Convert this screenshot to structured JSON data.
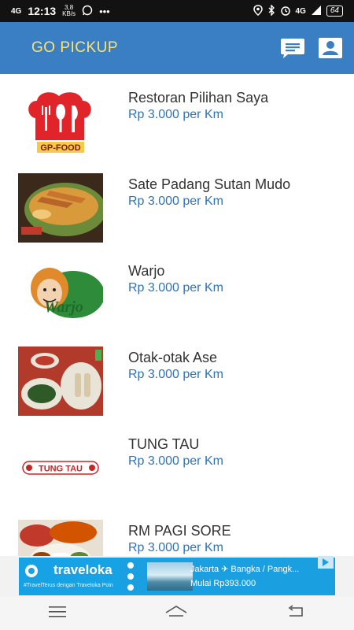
{
  "status_bar": {
    "network_left": "4G",
    "time": "12:13",
    "speed_value": "3,8",
    "speed_unit": "KB/s",
    "more": "•••",
    "network_right": "4G",
    "battery": "64"
  },
  "app_bar": {
    "title": "GO PICKUP",
    "chat_icon": "chat-icon",
    "profile_icon": "profile-icon"
  },
  "restaurants": [
    {
      "name": "Restoran Pilihan Saya",
      "price": "Rp 3.000 per Km",
      "logo_text": "GP-FOOD"
    },
    {
      "name": "Sate Padang Sutan Mudo",
      "price": "Rp 3.000 per Km"
    },
    {
      "name": "Warjo",
      "price": "Rp 3.000 per Km",
      "logo_text": "Warjo"
    },
    {
      "name": "Otak-otak Ase",
      "price": "Rp 3.000 per Km"
    },
    {
      "name": "TUNG TAU",
      "price": "Rp 3.000 per Km",
      "logo_text": "TUNG TAU"
    },
    {
      "name": "RM PAGI SORE",
      "price": "Rp 3.000 per Km"
    }
  ],
  "ad": {
    "brand": "traveloka",
    "tagline": "#TravelTerus dengan Traveloka Poin",
    "route": "Jakarta ✈ Bangka / Pangk...",
    "offer": "Mulai Rp393.000"
  },
  "nav_bar": {
    "menu_icon": "menu-icon",
    "home_icon": "home-icon",
    "back_icon": "back-icon"
  },
  "colors": {
    "app_bar": "#3a7ec4",
    "title": "#ffe36a",
    "price": "#2f73b7",
    "name": "#333333"
  }
}
